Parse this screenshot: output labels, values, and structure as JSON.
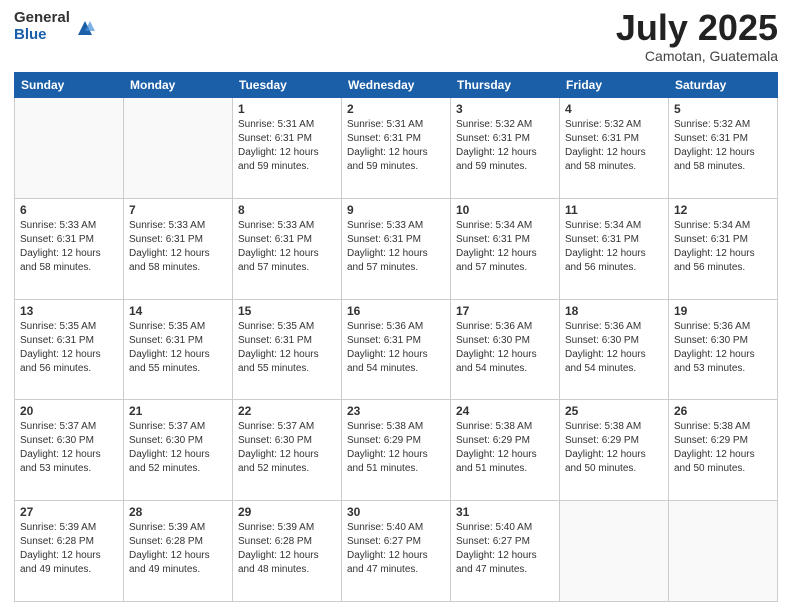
{
  "logo": {
    "general": "General",
    "blue": "Blue"
  },
  "header": {
    "month": "July 2025",
    "location": "Camotan, Guatemala"
  },
  "weekdays": [
    "Sunday",
    "Monday",
    "Tuesday",
    "Wednesday",
    "Thursday",
    "Friday",
    "Saturday"
  ],
  "weeks": [
    [
      {
        "day": "",
        "lines": []
      },
      {
        "day": "",
        "lines": []
      },
      {
        "day": "1",
        "lines": [
          "Sunrise: 5:31 AM",
          "Sunset: 6:31 PM",
          "Daylight: 12 hours",
          "and 59 minutes."
        ]
      },
      {
        "day": "2",
        "lines": [
          "Sunrise: 5:31 AM",
          "Sunset: 6:31 PM",
          "Daylight: 12 hours",
          "and 59 minutes."
        ]
      },
      {
        "day": "3",
        "lines": [
          "Sunrise: 5:32 AM",
          "Sunset: 6:31 PM",
          "Daylight: 12 hours",
          "and 59 minutes."
        ]
      },
      {
        "day": "4",
        "lines": [
          "Sunrise: 5:32 AM",
          "Sunset: 6:31 PM",
          "Daylight: 12 hours",
          "and 58 minutes."
        ]
      },
      {
        "day": "5",
        "lines": [
          "Sunrise: 5:32 AM",
          "Sunset: 6:31 PM",
          "Daylight: 12 hours",
          "and 58 minutes."
        ]
      }
    ],
    [
      {
        "day": "6",
        "lines": [
          "Sunrise: 5:33 AM",
          "Sunset: 6:31 PM",
          "Daylight: 12 hours",
          "and 58 minutes."
        ]
      },
      {
        "day": "7",
        "lines": [
          "Sunrise: 5:33 AM",
          "Sunset: 6:31 PM",
          "Daylight: 12 hours",
          "and 58 minutes."
        ]
      },
      {
        "day": "8",
        "lines": [
          "Sunrise: 5:33 AM",
          "Sunset: 6:31 PM",
          "Daylight: 12 hours",
          "and 57 minutes."
        ]
      },
      {
        "day": "9",
        "lines": [
          "Sunrise: 5:33 AM",
          "Sunset: 6:31 PM",
          "Daylight: 12 hours",
          "and 57 minutes."
        ]
      },
      {
        "day": "10",
        "lines": [
          "Sunrise: 5:34 AM",
          "Sunset: 6:31 PM",
          "Daylight: 12 hours",
          "and 57 minutes."
        ]
      },
      {
        "day": "11",
        "lines": [
          "Sunrise: 5:34 AM",
          "Sunset: 6:31 PM",
          "Daylight: 12 hours",
          "and 56 minutes."
        ]
      },
      {
        "day": "12",
        "lines": [
          "Sunrise: 5:34 AM",
          "Sunset: 6:31 PM",
          "Daylight: 12 hours",
          "and 56 minutes."
        ]
      }
    ],
    [
      {
        "day": "13",
        "lines": [
          "Sunrise: 5:35 AM",
          "Sunset: 6:31 PM",
          "Daylight: 12 hours",
          "and 56 minutes."
        ]
      },
      {
        "day": "14",
        "lines": [
          "Sunrise: 5:35 AM",
          "Sunset: 6:31 PM",
          "Daylight: 12 hours",
          "and 55 minutes."
        ]
      },
      {
        "day": "15",
        "lines": [
          "Sunrise: 5:35 AM",
          "Sunset: 6:31 PM",
          "Daylight: 12 hours",
          "and 55 minutes."
        ]
      },
      {
        "day": "16",
        "lines": [
          "Sunrise: 5:36 AM",
          "Sunset: 6:31 PM",
          "Daylight: 12 hours",
          "and 54 minutes."
        ]
      },
      {
        "day": "17",
        "lines": [
          "Sunrise: 5:36 AM",
          "Sunset: 6:30 PM",
          "Daylight: 12 hours",
          "and 54 minutes."
        ]
      },
      {
        "day": "18",
        "lines": [
          "Sunrise: 5:36 AM",
          "Sunset: 6:30 PM",
          "Daylight: 12 hours",
          "and 54 minutes."
        ]
      },
      {
        "day": "19",
        "lines": [
          "Sunrise: 5:36 AM",
          "Sunset: 6:30 PM",
          "Daylight: 12 hours",
          "and 53 minutes."
        ]
      }
    ],
    [
      {
        "day": "20",
        "lines": [
          "Sunrise: 5:37 AM",
          "Sunset: 6:30 PM",
          "Daylight: 12 hours",
          "and 53 minutes."
        ]
      },
      {
        "day": "21",
        "lines": [
          "Sunrise: 5:37 AM",
          "Sunset: 6:30 PM",
          "Daylight: 12 hours",
          "and 52 minutes."
        ]
      },
      {
        "day": "22",
        "lines": [
          "Sunrise: 5:37 AM",
          "Sunset: 6:30 PM",
          "Daylight: 12 hours",
          "and 52 minutes."
        ]
      },
      {
        "day": "23",
        "lines": [
          "Sunrise: 5:38 AM",
          "Sunset: 6:29 PM",
          "Daylight: 12 hours",
          "and 51 minutes."
        ]
      },
      {
        "day": "24",
        "lines": [
          "Sunrise: 5:38 AM",
          "Sunset: 6:29 PM",
          "Daylight: 12 hours",
          "and 51 minutes."
        ]
      },
      {
        "day": "25",
        "lines": [
          "Sunrise: 5:38 AM",
          "Sunset: 6:29 PM",
          "Daylight: 12 hours",
          "and 50 minutes."
        ]
      },
      {
        "day": "26",
        "lines": [
          "Sunrise: 5:38 AM",
          "Sunset: 6:29 PM",
          "Daylight: 12 hours",
          "and 50 minutes."
        ]
      }
    ],
    [
      {
        "day": "27",
        "lines": [
          "Sunrise: 5:39 AM",
          "Sunset: 6:28 PM",
          "Daylight: 12 hours",
          "and 49 minutes."
        ]
      },
      {
        "day": "28",
        "lines": [
          "Sunrise: 5:39 AM",
          "Sunset: 6:28 PM",
          "Daylight: 12 hours",
          "and 49 minutes."
        ]
      },
      {
        "day": "29",
        "lines": [
          "Sunrise: 5:39 AM",
          "Sunset: 6:28 PM",
          "Daylight: 12 hours",
          "and 48 minutes."
        ]
      },
      {
        "day": "30",
        "lines": [
          "Sunrise: 5:40 AM",
          "Sunset: 6:27 PM",
          "Daylight: 12 hours",
          "and 47 minutes."
        ]
      },
      {
        "day": "31",
        "lines": [
          "Sunrise: 5:40 AM",
          "Sunset: 6:27 PM",
          "Daylight: 12 hours",
          "and 47 minutes."
        ]
      },
      {
        "day": "",
        "lines": []
      },
      {
        "day": "",
        "lines": []
      }
    ]
  ]
}
